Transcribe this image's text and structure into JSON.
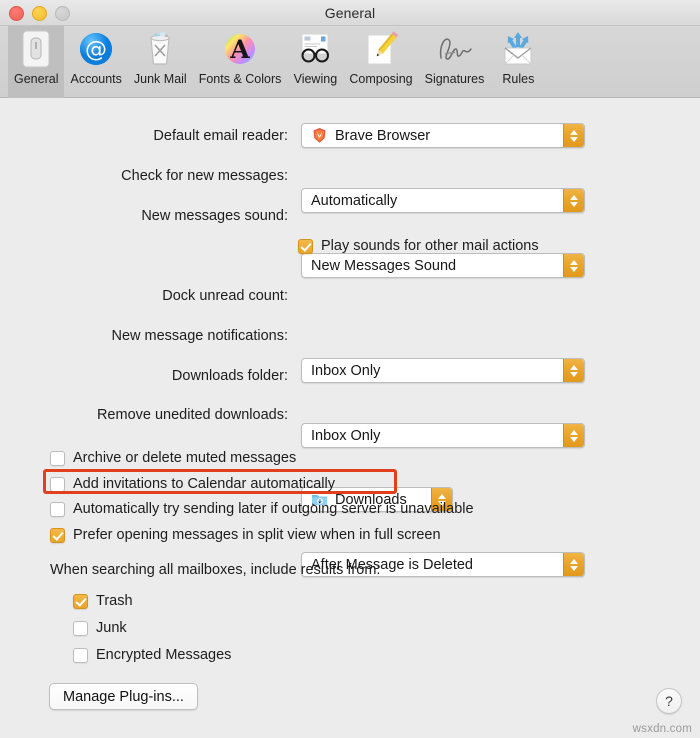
{
  "window": {
    "title": "General",
    "controls": {
      "close": "close",
      "minimize": "minimize",
      "zoom": "zoom"
    }
  },
  "toolbar": {
    "items": [
      {
        "label": "General",
        "icon": "general-switch-icon",
        "selected": true
      },
      {
        "label": "Accounts",
        "icon": "at-sign-icon",
        "selected": false
      },
      {
        "label": "Junk Mail",
        "icon": "trash-can-icon",
        "selected": false
      },
      {
        "label": "Fonts & Colors",
        "icon": "color-wheel-a-icon",
        "selected": false
      },
      {
        "label": "Viewing",
        "icon": "eyeglasses-icon",
        "selected": false
      },
      {
        "label": "Composing",
        "icon": "pencil-paper-icon",
        "selected": false
      },
      {
        "label": "Signatures",
        "icon": "signature-icon",
        "selected": false
      },
      {
        "label": "Rules",
        "icon": "envelope-arrows-icon",
        "selected": false
      }
    ]
  },
  "form": {
    "default_email_reader": {
      "label": "Default email reader:",
      "value": "Brave Browser",
      "icon": "brave-lion-icon"
    },
    "check_new_messages": {
      "label": "Check for new messages:",
      "value": "Automatically"
    },
    "new_messages_sound": {
      "label": "New messages sound:",
      "value": "New Messages Sound"
    },
    "play_sounds": {
      "label": "Play sounds for other mail actions",
      "checked": true
    },
    "dock_unread_count": {
      "label": "Dock unread count:",
      "value": "Inbox Only"
    },
    "new_message_notifications": {
      "label": "New message notifications:",
      "value": "Inbox Only"
    },
    "downloads_folder": {
      "label": "Downloads folder:",
      "value": "Downloads",
      "icon": "downloads-folder-icon"
    },
    "remove_unedited_downloads": {
      "label": "Remove unedited downloads:",
      "value": "After Message is Deleted"
    }
  },
  "checkboxes": [
    {
      "label": "Archive or delete muted messages",
      "checked": false,
      "highlighted": false
    },
    {
      "label": "Add invitations to Calendar automatically",
      "checked": false,
      "highlighted": true
    },
    {
      "label": "Automatically try sending later if outgoing server is unavailable",
      "checked": false,
      "highlighted": false
    },
    {
      "label": "Prefer opening messages in split view when in full screen",
      "checked": true,
      "highlighted": false
    }
  ],
  "search_section": {
    "heading": "When searching all mailboxes, include results from:",
    "options": [
      {
        "label": "Trash",
        "checked": true
      },
      {
        "label": "Junk",
        "checked": false
      },
      {
        "label": "Encrypted Messages",
        "checked": false
      }
    ]
  },
  "footer": {
    "manage_plugins_label": "Manage Plug-ins...",
    "help_label": "?",
    "watermark": "wsxdn.com"
  },
  "colors": {
    "accent_amber": "#eaa42a",
    "annotation_red": "#e0401c",
    "window_bg": "#ececec",
    "toolbar_bg": "#d4d4d4"
  }
}
